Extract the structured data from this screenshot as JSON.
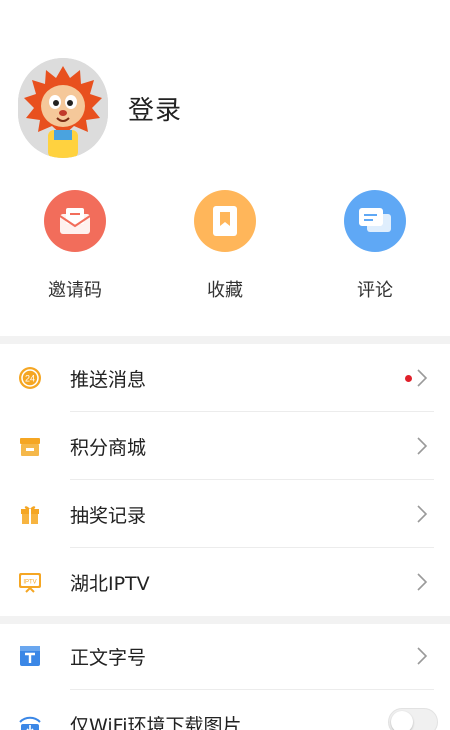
{
  "profile": {
    "login_label": "登录"
  },
  "quick_actions": [
    {
      "label": "邀请码",
      "icon": "envelope-icon",
      "color": "#f26d5b"
    },
    {
      "label": "收藏",
      "icon": "bookmark-icon",
      "color": "#ffb65a"
    },
    {
      "label": "评论",
      "icon": "chat-bubbles-icon",
      "color": "#5fa8f5"
    }
  ],
  "menu_group_1": [
    {
      "label": "推送消息",
      "icon": "push-24-icon",
      "has_red_dot": true
    },
    {
      "label": "积分商城",
      "icon": "store-icon"
    },
    {
      "label": "抽奖记录",
      "icon": "gift-icon"
    },
    {
      "label": "湖北IPTV",
      "icon": "tv-icon"
    }
  ],
  "menu_group_2": [
    {
      "label": "正文字号",
      "icon": "font-size-icon"
    },
    {
      "label": "仅WiFi环境下载图片",
      "icon": "wifi-download-icon",
      "toggle": false
    }
  ],
  "colors": {
    "accent_orange": "#f5a623",
    "blue_icon": "#3b87e6",
    "red_dot": "#e0202a",
    "band_gray": "#f2f2f2"
  }
}
